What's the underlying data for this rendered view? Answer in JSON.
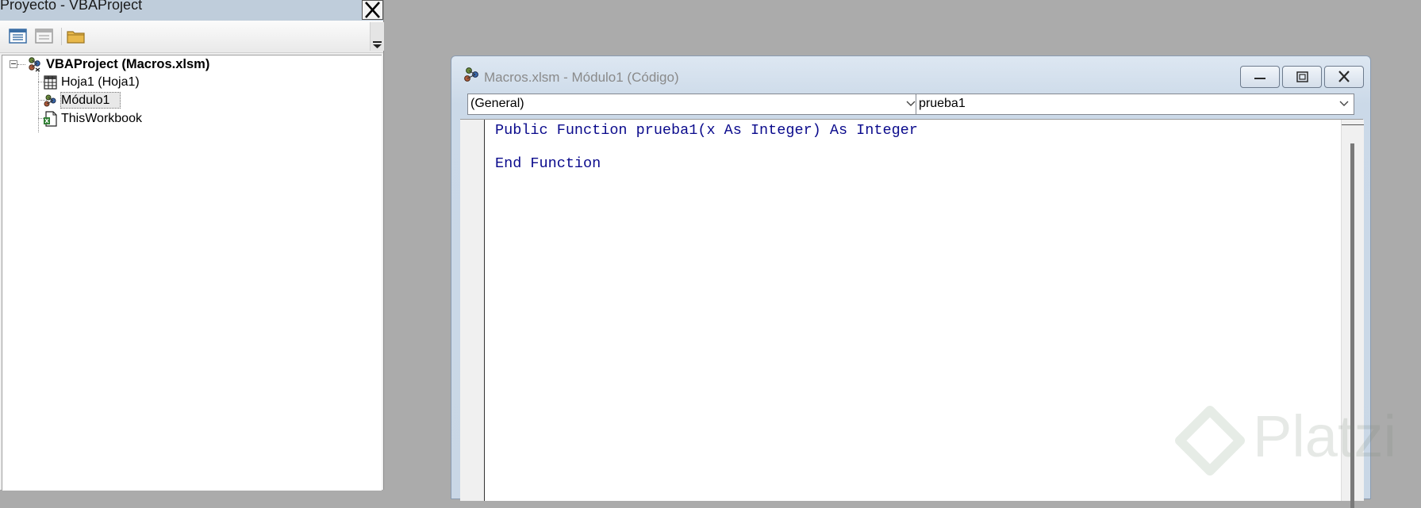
{
  "project_explorer": {
    "title": "Proyecto - VBAProject",
    "toolbar": [
      "view-code-icon",
      "view-object-icon",
      "toggle-folders-icon"
    ],
    "tree": {
      "root": "VBAProject (Macros.xlsm)",
      "items": [
        {
          "label": "Hoja1 (Hoja1)",
          "icon": "worksheet-icon"
        },
        {
          "label": "Módulo1",
          "icon": "module-icon",
          "selected": true
        },
        {
          "label": "ThisWorkbook",
          "icon": "workbook-icon"
        }
      ]
    }
  },
  "code_window": {
    "title": "Macros.xlsm - Módulo1 (Código)",
    "object_combo": "(General)",
    "procedure_combo": "prueba1",
    "code_lines": [
      "Public Function prueba1(x As Integer) As Integer",
      "End Function"
    ]
  },
  "watermark": "Platzi",
  "colors": {
    "background": "#ababab",
    "code_text": "#0a0a8c",
    "pane_title": "#bfcddb"
  }
}
